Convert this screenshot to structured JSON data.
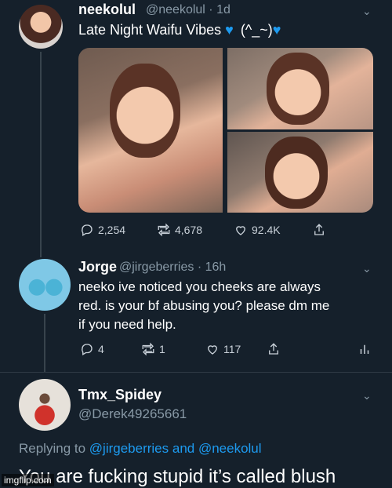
{
  "tweet1": {
    "display_name": "neekolul",
    "handle": "@neekolul",
    "time": "· 1d",
    "text_main": "Late Night Waifu Vibes",
    "text_emote": "(^_~)",
    "actions": {
      "replies": "2,254",
      "retweets": "4,678",
      "likes": "92.4K"
    }
  },
  "tweet2": {
    "display_name": "Jorge",
    "handle": "@jirgeberries",
    "time": "· 16h",
    "lines": [
      "neeko ive noticed you cheeks are always",
      "red. is your bf abusing you? please dm me",
      "if you need help."
    ],
    "actions": {
      "replies": "4",
      "retweets": "1",
      "likes": "117"
    }
  },
  "tweet3": {
    "display_name": "Tmx_Spidey",
    "handle": "@Derek49265661",
    "replying_prefix": "Replying to",
    "replying_users": "@jirgeberries and @neekolul",
    "text": "You are fucking stupid it’s called blush"
  },
  "watermark": "imgflip.com",
  "colors": {
    "background": "#15202b",
    "accent": "#1d9bf0",
    "muted": "#8899a6"
  }
}
